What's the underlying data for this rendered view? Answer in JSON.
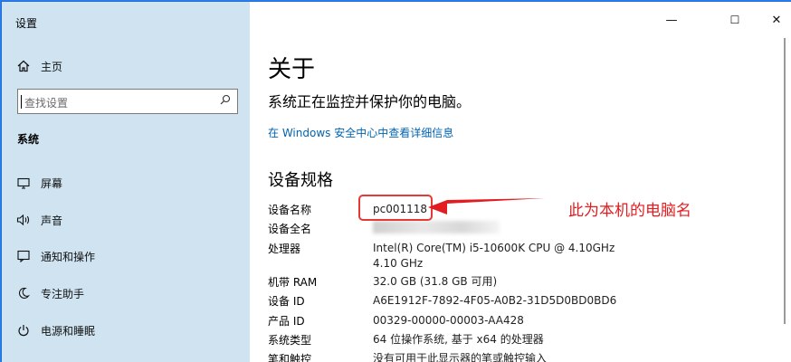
{
  "window": {
    "title": "设置",
    "controls": {
      "minimize": "—",
      "maximize": "☐",
      "close": "✕"
    }
  },
  "sidebar": {
    "home": {
      "label": "主页",
      "icon": "home-icon"
    },
    "search": {
      "placeholder": "查找设置",
      "icon": "search-icon"
    },
    "section": "系统",
    "items": [
      {
        "label": "屏幕",
        "icon": "monitor-icon"
      },
      {
        "label": "声音",
        "icon": "speaker-icon"
      },
      {
        "label": "通知和操作",
        "icon": "notification-icon"
      },
      {
        "label": "专注助手",
        "icon": "moon-icon"
      },
      {
        "label": "电源和睡眠",
        "icon": "power-icon"
      }
    ]
  },
  "main": {
    "title": "关于",
    "subtitle": "系统正在监控并保护你的电脑。",
    "security_link": "在 Windows 安全中心中查看详细信息",
    "specs_heading": "设备规格",
    "specs": [
      {
        "label": "设备名称",
        "value": "pc001118"
      },
      {
        "label": "设备全名",
        "value": ""
      },
      {
        "label": "处理器",
        "value": "Intel(R) Core(TM) i5-10600K CPU @ 4.10GHz   4.10 GHz"
      },
      {
        "label": "机带 RAM",
        "value": "32.0 GB (31.8 GB 可用)"
      },
      {
        "label": "设备 ID",
        "value": "A6E1912F-7892-4F05-A0B2-31D5D0BD0BD6"
      },
      {
        "label": "产品 ID",
        "value": "00329-00000-00003-AA428"
      },
      {
        "label": "系统类型",
        "value": "64 位操作系统, 基于 x64 的处理器"
      },
      {
        "label": "笔和触控",
        "value": "没有可用于此显示器的笔或触控输入"
      }
    ],
    "annotation": "此为本机的电脑名",
    "annotation_color": "#e11d21"
  },
  "colors": {
    "sidebar_bg": "#cfe3f1",
    "link": "#0063b1",
    "accent_border": "#2b7de9"
  }
}
